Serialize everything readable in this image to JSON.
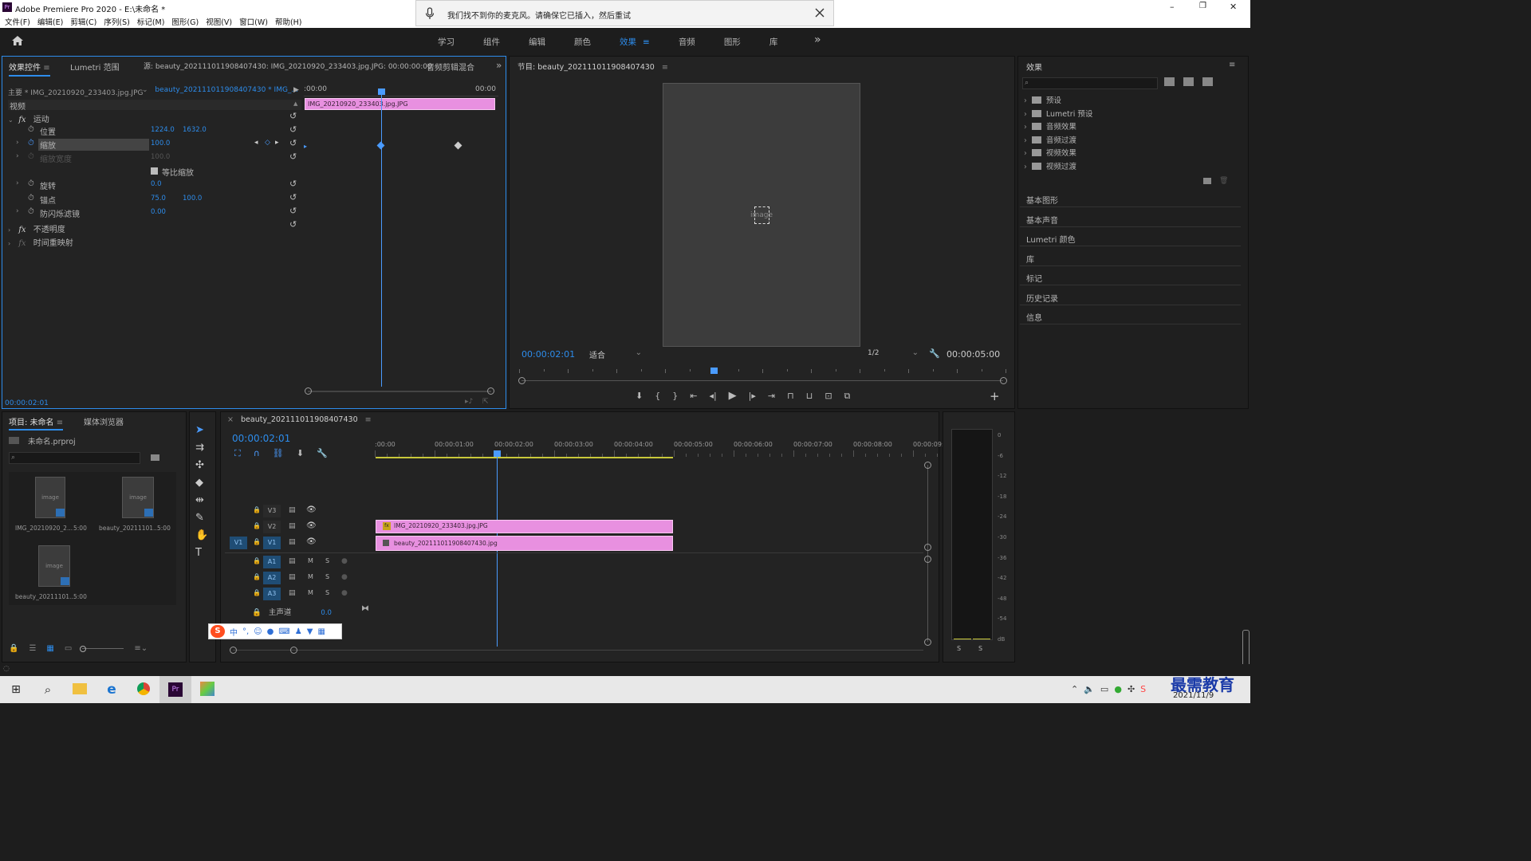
{
  "window": {
    "app_icon": "Pr",
    "title": "Adobe Premiere Pro 2020 - E:\\未命名 *",
    "minimize": "–",
    "maximize": "❐",
    "close": "✕"
  },
  "menu": [
    "文件(F)",
    "编辑(E)",
    "剪辑(C)",
    "序列(S)",
    "标记(M)",
    "图形(G)",
    "视图(V)",
    "窗口(W)",
    "帮助(H)"
  ],
  "notification": {
    "text": "我们找不到你的麦克风。请确保它已插入，然后重试"
  },
  "workspaces": {
    "items": [
      "学习",
      "组件",
      "编辑",
      "颜色",
      "效果",
      "音频",
      "图形",
      "库"
    ],
    "active": "效果",
    "more": "»"
  },
  "effect_controls": {
    "tabs": [
      "效果控件",
      "Lumetri 范围",
      "源: beauty_202111011908407430: IMG_20210920_233403.jpg.JPG: 00:00:00:00",
      "音频剪辑混合"
    ],
    "master": "主要 * IMG_20210920_233403.jpg.JPG",
    "sequence": "beauty_202111011908407430 * IMG_...",
    "ruler_start": ":00:00",
    "ruler_end": "00:00",
    "clip_label": "IMG_20210920_233403.jpg.JPG",
    "video_label": "视频",
    "motion_label": "运动",
    "props": [
      {
        "name": "位置",
        "v1": "1224.0",
        "v2": "1632.0"
      },
      {
        "name": "缩放",
        "v1": "100.0"
      },
      {
        "name": "缩放宽度",
        "v1": "100.0"
      },
      {
        "name": "等比缩放"
      },
      {
        "name": "旋转",
        "v1": "0.0"
      },
      {
        "name": "锚点",
        "v1": "75.0",
        "v2": "100.0"
      },
      {
        "name": "防闪烁滤镜",
        "v1": "0.00"
      }
    ],
    "opacity_label": "不透明度",
    "timeremap_label": "时间重映射",
    "timecode": "00:00:02:01"
  },
  "program": {
    "title": "节目: beauty_202111011908407430",
    "timecode": "00:00:02:01",
    "fit": "适合",
    "resolution": "1/2",
    "duration": "00:00:05:00",
    "playhead_fraction": 0.4,
    "image_placeholder": "image"
  },
  "effects_panel": {
    "title": "效果",
    "tree": [
      "预设",
      "Lumetri 预设",
      "音频效果",
      "音频过渡",
      "视频效果",
      "视频过渡"
    ],
    "sections": [
      "基本图形",
      "基本声音",
      "Lumetri 颜色",
      "库",
      "标记",
      "历史记录",
      "信息"
    ]
  },
  "project": {
    "tabs": [
      "项目: 未命名",
      "媒体浏览器"
    ],
    "file": "未命名.prproj",
    "items": [
      {
        "name": "IMG_20210920_2...",
        "dur": "5:00"
      },
      {
        "name": "beauty_20211101...",
        "dur": "5:00"
      },
      {
        "name": "beauty_20211101...",
        "dur": "5:00"
      }
    ],
    "thumb_placeholder": "image"
  },
  "timeline": {
    "tab": "beauty_202111011908407430",
    "timecode": "00:00:02:01",
    "ruler": [
      ":00:00",
      "00:00:01:00",
      "00:00:02:00",
      "00:00:03:00",
      "00:00:04:00",
      "00:00:05:00",
      "00:00:06:00",
      "00:00:07:00",
      "00:00:08:00",
      "00:00:09:"
    ],
    "tracks_v": [
      "V3",
      "V2",
      "V1"
    ],
    "tracks_a": [
      "A1",
      "A2",
      "A3"
    ],
    "src_v1": "V1",
    "master": "主声道",
    "master_val": "0.0",
    "clip_v2": "IMG_20210920_233403.jpg.JPG",
    "clip_v1": "beauty_202111011908407430.jpg",
    "M": "M",
    "S": "S"
  },
  "meter": {
    "scale": [
      "0",
      "-6",
      "-12",
      "-18",
      "-24",
      "-30",
      "-36",
      "-42",
      "-48",
      "-54",
      "dB"
    ],
    "solo": [
      "S",
      "S"
    ]
  },
  "ime": {
    "text": "中"
  },
  "taskbar": {
    "date": "2021/11/9",
    "watermark": "最需教育"
  },
  "colors": {
    "accent": "#2d8ceb",
    "clip": "#e890e0",
    "playhead": "#4a9bff"
  }
}
